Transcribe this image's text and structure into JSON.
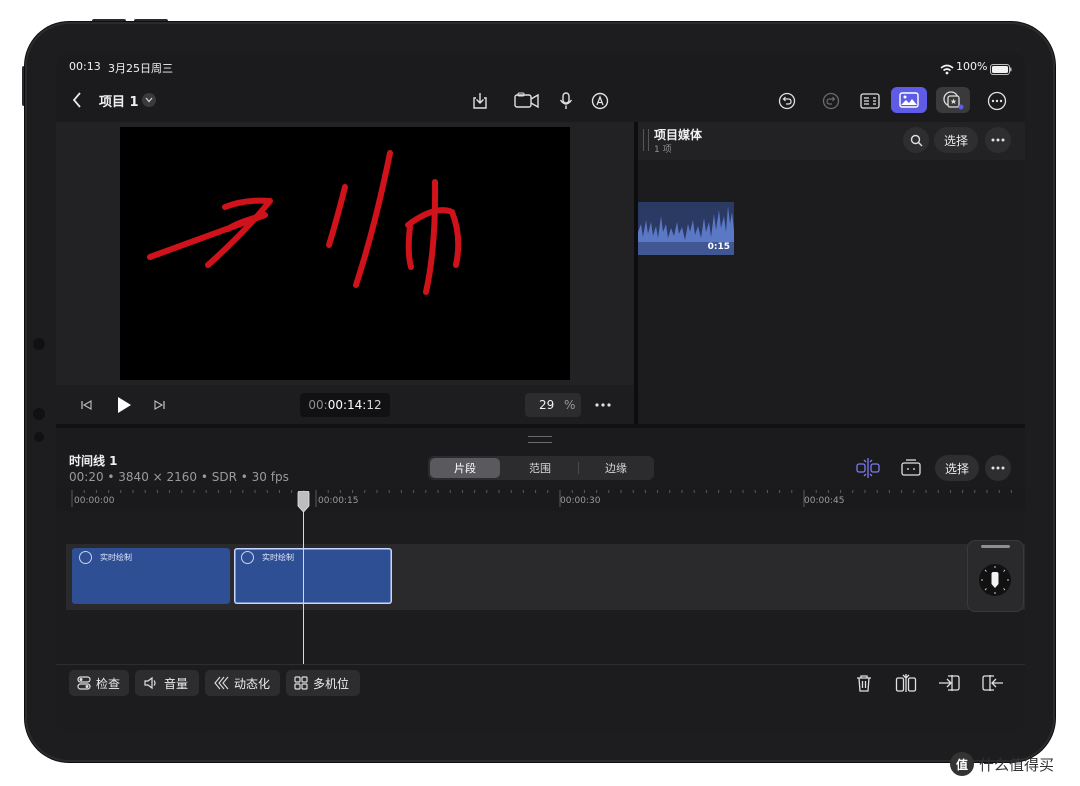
{
  "status_bar": {
    "time": "00:13",
    "date": "3月25日周三",
    "battery": "100%"
  },
  "nav": {
    "project_title": "项目 1"
  },
  "viewer": {
    "timecode_prefix": "00:",
    "timecode_main": "00:14:",
    "timecode_frames": "12",
    "zoom_value": "29",
    "zoom_unit": "%"
  },
  "media_panel": {
    "title": "项目媒体",
    "count": "1 项",
    "select_label": "选择",
    "clip_duration": "0:15"
  },
  "timeline": {
    "name": "时间线 1",
    "info": "00:20 • 3840 × 2160 • SDR • 30 fps",
    "segments": [
      "片段",
      "范围",
      "边缘"
    ],
    "select_label": "选择",
    "ruler_labels": [
      "00:00:00",
      "00:00:15",
      "00:00:30",
      "00:00:45"
    ],
    "clips": [
      {
        "label": "实时绘制"
      },
      {
        "label": "实时绘制"
      }
    ]
  },
  "bottom_tools": {
    "inspect": "检查",
    "volume": "音量",
    "animate": "动态化",
    "multicam": "多机位"
  },
  "watermark": {
    "text": "什么值得买",
    "logo_char": "值"
  },
  "colors": {
    "accent": "#5e5ce6",
    "clip_blue": "#2f4f95",
    "drawing_red": "#d0121b"
  }
}
